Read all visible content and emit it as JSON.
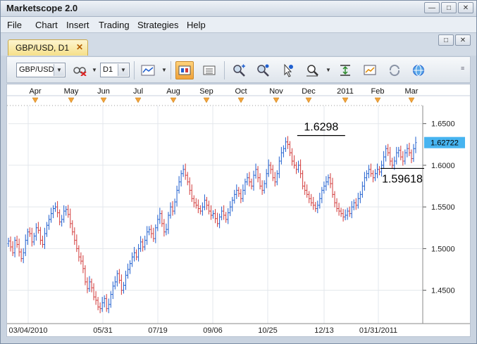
{
  "app": {
    "title": "Marketscope 2.0"
  },
  "menu": [
    "File",
    "Chart",
    "Insert",
    "Trading",
    "Strategies",
    "Help"
  ],
  "document_tab": {
    "label": "GBP/USD, D1"
  },
  "toolbar": {
    "instrument": "GBP/USD",
    "timeframe": "D1"
  },
  "colors": {
    "up": "#1f5fcf",
    "down": "#d23b3b",
    "price_marker": "#47b4f0",
    "tab": "#f6e08a",
    "active_button": "#f0a23a"
  },
  "chart_data": {
    "type": "ohlc",
    "instrument": "GBP/USD",
    "timeframe": "D1",
    "y_range": [
      1.41,
      1.67
    ],
    "yticks": [
      "1.6500",
      "1.6000",
      "1.5500",
      "1.5000",
      "1.4500"
    ],
    "ytick_values": [
      1.65,
      1.6,
      1.55,
      1.5,
      1.45
    ],
    "months": [
      "Apr",
      "May",
      "Jun",
      "Jul",
      "Aug",
      "Sep",
      "Oct",
      "Nov",
      "Dec",
      "2011",
      "Feb",
      "Mar"
    ],
    "date_labels": [
      "03/04/2010",
      "05/31",
      "07/19",
      "09/06",
      "10/25",
      "12/13",
      "01/31/2011"
    ],
    "current_price": "1.62722",
    "annotations": [
      {
        "text": "1.6298",
        "value": 1.6298
      },
      {
        "text": "1.59618",
        "value": 1.59618
      }
    ],
    "closes": [
      1.509,
      1.502,
      1.495,
      1.51,
      1.505,
      1.496,
      1.488,
      1.495,
      1.51,
      1.52,
      1.518,
      1.508,
      1.515,
      1.525,
      1.522,
      1.51,
      1.505,
      1.518,
      1.528,
      1.535,
      1.542,
      1.548,
      1.55,
      1.543,
      1.532,
      1.535,
      1.545,
      1.547,
      1.541,
      1.53,
      1.52,
      1.51,
      1.5,
      1.49,
      1.485,
      1.476,
      1.46,
      1.452,
      1.46,
      1.453,
      1.442,
      1.438,
      1.43,
      1.428,
      1.435,
      1.44,
      1.428,
      1.433,
      1.445,
      1.455,
      1.46,
      1.47,
      1.462,
      1.45,
      1.456,
      1.468,
      1.475,
      1.482,
      1.49,
      1.495,
      1.49,
      1.5,
      1.508,
      1.502,
      1.51,
      1.52,
      1.523,
      1.518,
      1.512,
      1.525,
      1.535,
      1.542,
      1.53,
      1.52,
      1.523,
      1.54,
      1.55,
      1.545,
      1.556,
      1.57,
      1.58,
      1.59,
      1.595,
      1.588,
      1.58,
      1.57,
      1.56,
      1.555,
      1.552,
      1.548,
      1.545,
      1.55,
      1.558,
      1.552,
      1.545,
      1.54,
      1.542,
      1.536,
      1.53,
      1.538,
      1.545,
      1.54,
      1.535,
      1.543,
      1.55,
      1.558,
      1.565,
      1.57,
      1.566,
      1.56,
      1.57,
      1.58,
      1.585,
      1.58,
      1.575,
      1.588,
      1.595,
      1.585,
      1.575,
      1.57,
      1.578,
      1.59,
      1.6,
      1.595,
      1.585,
      1.58,
      1.59,
      1.605,
      1.615,
      1.62,
      1.628,
      1.625,
      1.615,
      1.605,
      1.6,
      1.595,
      1.6,
      1.59,
      1.575,
      1.57,
      1.565,
      1.56,
      1.555,
      1.552,
      1.548,
      1.552,
      1.56,
      1.57,
      1.575,
      1.58,
      1.585,
      1.578,
      1.565,
      1.555,
      1.548,
      1.545,
      1.542,
      1.538,
      1.54,
      1.545,
      1.542,
      1.55,
      1.555,
      1.552,
      1.56,
      1.565,
      1.575,
      1.585,
      1.59,
      1.595,
      1.59,
      1.585,
      1.59,
      1.595,
      1.592,
      1.6,
      1.61,
      1.62,
      1.615,
      1.605,
      1.6,
      1.605,
      1.615,
      1.618,
      1.61,
      1.605,
      1.615,
      1.62,
      1.615,
      1.608,
      1.62,
      1.6272
    ]
  }
}
